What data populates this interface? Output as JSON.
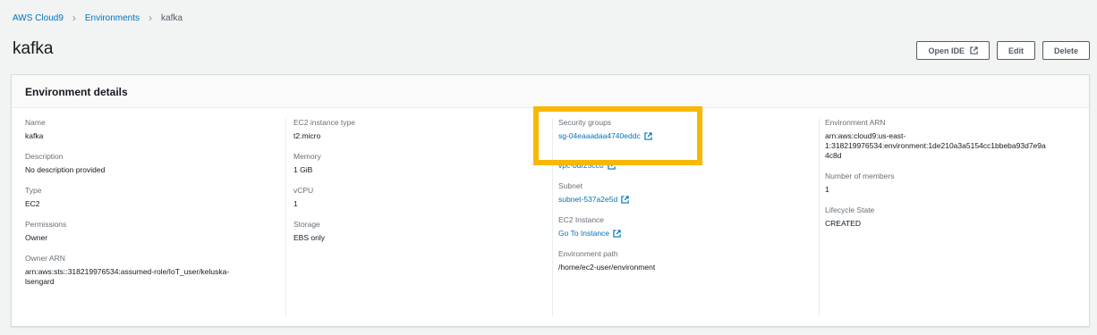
{
  "breadcrumb": {
    "root": "AWS Cloud9",
    "section": "Environments",
    "current": "kafka"
  },
  "page": {
    "title": "kafka"
  },
  "actions": {
    "open_ide": "Open IDE",
    "edit": "Edit",
    "delete": "Delete"
  },
  "panel": {
    "title": "Environment details"
  },
  "col1": {
    "name_label": "Name",
    "name_value": "kafka",
    "description_label": "Description",
    "description_value": "No description provided",
    "type_label": "Type",
    "type_value": "EC2",
    "permissions_label": "Permissions",
    "permissions_value": "Owner",
    "owner_arn_label": "Owner ARN",
    "owner_arn_line1": "arn:aws:sts::318219976534:assumed-role/IoT_user/keluska-",
    "owner_arn_line2": "lsengard"
  },
  "col2": {
    "instance_type_label": "EC2 instance type",
    "instance_type_value": "t2.micro",
    "memory_label": "Memory",
    "memory_value": "1 GiB",
    "vcpu_label": "vCPU",
    "vcpu_value": "1",
    "storage_label": "Storage",
    "storage_value": "EBS only"
  },
  "col3": {
    "security_groups_label": "Security groups",
    "security_groups_value": "sg-04eaaadaa4740eddc",
    "vpc_value": "vpc-bdf25cc0",
    "subnet_label": "Subnet",
    "subnet_value": "subnet-537a2e5d",
    "ec2_instance_label": "EC2 Instance",
    "ec2_instance_value": "Go To Instance",
    "env_path_label": "Environment path",
    "env_path_value": "/home/ec2-user/environment"
  },
  "col4": {
    "env_arn_label": "Environment ARN",
    "env_arn_line1": "arn:aws:cloud9:us-east-",
    "env_arn_line2": "1:318219976534:environment:1de210a3a5154cc1bbeba93d7e9a",
    "env_arn_line3": "4c8d",
    "members_label": "Number of members",
    "members_value": "1",
    "lifecycle_label": "Lifecycle State",
    "lifecycle_value": "CREATED"
  },
  "colors": {
    "link": "#0073bb",
    "highlight": "#f8b800",
    "background": "#f2f3f3"
  }
}
